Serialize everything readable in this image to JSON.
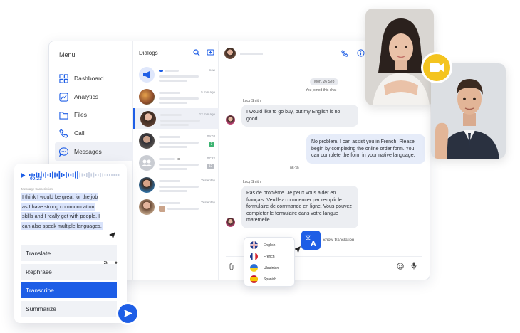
{
  "menu": {
    "title": "Menu",
    "items": [
      {
        "label": "Dashboard",
        "icon": "grid-icon"
      },
      {
        "label": "Analytics",
        "icon": "chart-icon"
      },
      {
        "label": "Files",
        "icon": "file-icon"
      },
      {
        "label": "Call",
        "icon": "phone-icon"
      },
      {
        "label": "Messages",
        "icon": "chat-icon"
      }
    ]
  },
  "dialogs": {
    "title": "Dialogs",
    "rows": [
      {
        "time": "now"
      },
      {
        "time": "5 min ago"
      },
      {
        "time": "12 min ago"
      },
      {
        "time": "09:03",
        "badge": "3"
      },
      {
        "time": "07:22",
        "badge": "12"
      },
      {
        "time": "Yesterday"
      },
      {
        "time": "Yesterday"
      }
    ]
  },
  "chat": {
    "date": "Mon, 26 Sep",
    "joined": "You joined this chat",
    "sender": "Lucy Smith",
    "msg1": "I would like to go buy, but my English is no good.",
    "msg2": "No problem. I can assist you in French. Please begin by completing the online order form. You can complete the form in your native language.",
    "msg2_time": "08:30",
    "sender2": "Lucy Smith",
    "msg3": "Pas de problème. Je peux vous aider en français. Veuillez commencer par remplir le formulaire de commande en ligne. Vous pouvez compléter le formulaire dans votre langue maternelle.",
    "show_translation": "Show translation"
  },
  "languages": [
    "English",
    "French",
    "Ukrainian",
    "Spanish"
  ],
  "voice": {
    "duration": "00:21",
    "transcript_label": "Message transcription",
    "transcript_lines": [
      "I think I would be great for the job",
      "as I have strong communication",
      "skills and I really get with people. I",
      "can also speak multiple languages."
    ]
  },
  "actions": [
    {
      "label": "Translate"
    },
    {
      "label": "Rephrase"
    },
    {
      "label": "Transcribe",
      "active": true
    },
    {
      "label": "Summarize"
    }
  ],
  "colors": {
    "accent": "#1e5ee6",
    "camera": "#f4c41f",
    "online": "#3cb371"
  }
}
